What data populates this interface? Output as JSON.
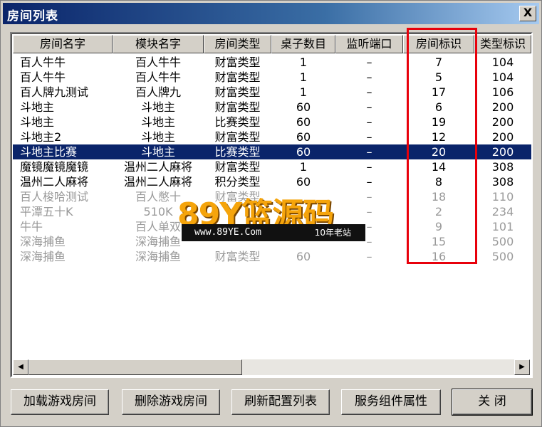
{
  "window": {
    "title": "房间列表",
    "close_label": "X"
  },
  "columns": [
    {
      "label": "房间名字",
      "w": 140
    },
    {
      "label": "模块名字",
      "w": 128
    },
    {
      "label": "房间类型",
      "w": 95
    },
    {
      "label": "桌子数目",
      "w": 90
    },
    {
      "label": "监听端口",
      "w": 95
    },
    {
      "label": "房间标识",
      "w": 100
    },
    {
      "label": "类型标识",
      "w": 80
    }
  ],
  "rows": [
    {
      "name": "百人牛牛",
      "module": "百人牛牛",
      "type": "财富类型",
      "tables": "1",
      "port": "–",
      "id": "7",
      "type_id": "104",
      "state": "normal"
    },
    {
      "name": "百人牛牛",
      "module": "百人牛牛",
      "type": "财富类型",
      "tables": "1",
      "port": "–",
      "id": "5",
      "type_id": "104",
      "state": "normal"
    },
    {
      "name": "百人牌九测试",
      "module": "百人牌九",
      "type": "财富类型",
      "tables": "1",
      "port": "–",
      "id": "17",
      "type_id": "106",
      "state": "normal"
    },
    {
      "name": "斗地主",
      "module": "斗地主",
      "type": "财富类型",
      "tables": "60",
      "port": "–",
      "id": "6",
      "type_id": "200",
      "state": "normal"
    },
    {
      "name": "斗地主",
      "module": "斗地主",
      "type": "比赛类型",
      "tables": "60",
      "port": "–",
      "id": "19",
      "type_id": "200",
      "state": "normal"
    },
    {
      "name": "斗地主2",
      "module": "斗地主",
      "type": "财富类型",
      "tables": "60",
      "port": "–",
      "id": "12",
      "type_id": "200",
      "state": "normal"
    },
    {
      "name": "斗地主比赛",
      "module": "斗地主",
      "type": "比赛类型",
      "tables": "60",
      "port": "–",
      "id": "20",
      "type_id": "200",
      "state": "selected"
    },
    {
      "name": "魔镜魔镜魔镜",
      "module": "温州二人麻将",
      "type": "财富类型",
      "tables": "1",
      "port": "–",
      "id": "14",
      "type_id": "308",
      "state": "normal"
    },
    {
      "name": "温州二人麻将",
      "module": "温州二人麻将",
      "type": "积分类型",
      "tables": "60",
      "port": "–",
      "id": "8",
      "type_id": "308",
      "state": "normal"
    },
    {
      "name": "百人梭哈测试",
      "module": "百人憋十",
      "type": "财富类型",
      "tables": "",
      "port": "–",
      "id": "18",
      "type_id": "110",
      "state": "disabled"
    },
    {
      "name": "平潭五十K",
      "module": "510K",
      "type": "",
      "tables": "",
      "port": "–",
      "id": "2",
      "type_id": "234",
      "state": "disabled"
    },
    {
      "name": "牛牛",
      "module": "百人单双",
      "type": "",
      "tables": "",
      "port": "–",
      "id": "9",
      "type_id": "101",
      "state": "disabled"
    },
    {
      "name": "深海捕鱼",
      "module": "深海捕鱼",
      "type": "",
      "tables": "",
      "port": "–",
      "id": "15",
      "type_id": "500",
      "state": "disabled"
    },
    {
      "name": "深海捕鱼",
      "module": "深海捕鱼",
      "type": "财富类型",
      "tables": "60",
      "port": "–",
      "id": "16",
      "type_id": "500",
      "state": "disabled"
    }
  ],
  "buttons": {
    "load": "加载游戏房间",
    "delete": "删除游戏房间",
    "refresh": "刷新配置列表",
    "props": "服务组件属性",
    "close": "关 闭"
  },
  "watermark": {
    "logo": "89Y篮源码",
    "url": "www.89YE.Com",
    "tag": "10年老站"
  },
  "accent_colors": {
    "selection": "#0a246a",
    "highlight_box": "#e8000b",
    "watermark": "#f5a40b"
  }
}
